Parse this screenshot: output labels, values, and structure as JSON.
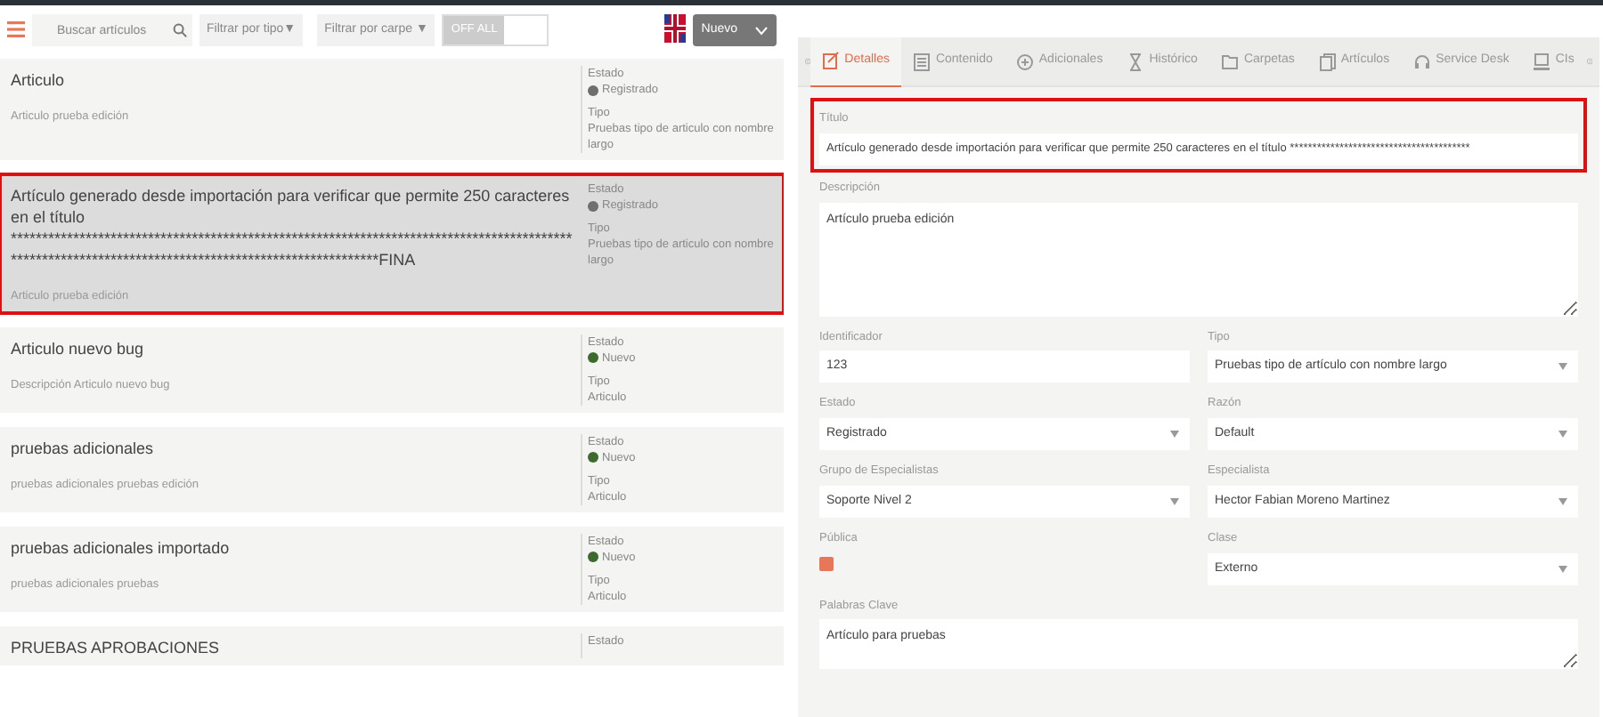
{
  "toolbar": {
    "search": {
      "placeholder": "Buscar artículos"
    },
    "filters": [
      {
        "label": "Filtrar por tipo▼"
      },
      {
        "label": "Filtrar por carpe ▼"
      }
    ],
    "toggle": {
      "label": "OFF ALL",
      "on": false
    },
    "new_button": {
      "label": "Nuevo"
    }
  },
  "articles": [
    {
      "title": "Articulo",
      "description": "Articulo prueba edición",
      "estado_label": "Estado",
      "status": "Registrado",
      "color": "#6f6f6f",
      "tipo_label": "Tipo",
      "tipo": "Pruebas tipo de articulo con nombre largo",
      "selected": false,
      "highlighted": false
    },
    {
      "title": "Artículo generado desde importación para verificar que permite 250 caracteres en el título *****************************************************************************************************************************************************FINA",
      "description": "Articulo prueba edición",
      "estado_label": "Estado",
      "status": "Registrado",
      "color": "#6f6f6f",
      "tipo_label": "Tipo",
      "tipo": "Pruebas tipo de articulo con nombre largo",
      "selected": true,
      "highlighted": true
    },
    {
      "title": "Articulo nuevo bug",
      "description": "Descripción Articulo nuevo bug",
      "estado_label": "Estado",
      "status": "Nuevo",
      "color": "#3d6b2f",
      "tipo_label": "Tipo",
      "tipo": "Articulo",
      "selected": false,
      "highlighted": false
    },
    {
      "title": "pruebas adicionales",
      "description": "pruebas adicionales pruebas edición",
      "estado_label": "Estado",
      "status": "Nuevo",
      "color": "#3d6b2f",
      "tipo_label": "Tipo",
      "tipo": "Articulo",
      "selected": false,
      "highlighted": false
    },
    {
      "title": "pruebas adicionales importado",
      "description": "pruebas adicionales pruebas",
      "estado_label": "Estado",
      "status": "Nuevo",
      "color": "#3d6b2f",
      "tipo_label": "Tipo",
      "tipo": "Articulo",
      "selected": false,
      "highlighted": false
    },
    {
      "title": "PRUEBAS APROBACIONES",
      "estado_label": "Estado",
      "selected": false,
      "highlighted": false
    }
  ],
  "tabs": [
    {
      "label": "Detalles",
      "selected": true
    },
    {
      "label": "Contenido",
      "selected": false
    },
    {
      "label": "Adicionales",
      "selected": false
    },
    {
      "label": "Histórico",
      "selected": false
    },
    {
      "label": "Carpetas",
      "selected": false
    },
    {
      "label": "Artículos",
      "selected": false
    },
    {
      "label": "Service Desk",
      "selected": false
    },
    {
      "label": "CIs",
      "selected": false
    }
  ],
  "form": {
    "title_field": {
      "label": "Título",
      "value": "Artículo generado desde importación para verificar que permite 250 caracteres en el título ****************************************",
      "highlighted": true
    },
    "fields": [
      {
        "kind": "textarea",
        "label": "Descripción",
        "value": "Artículo prueba edición"
      },
      {
        "kind": "text",
        "label": "Identificador",
        "value": "123"
      },
      {
        "kind": "select",
        "label": "Tipo",
        "value": "Pruebas tipo de artículo con nombre largo"
      },
      {
        "kind": "select",
        "label": "Estado",
        "value": "Registrado"
      },
      {
        "kind": "select",
        "label": "Razón",
        "value": "Default"
      },
      {
        "kind": "select",
        "label": "Grupo de Especialistas",
        "value": "Soporte Nivel 2"
      },
      {
        "kind": "select",
        "label": "Especialista",
        "value": "Hector Fabian Moreno Martinez"
      },
      {
        "kind": "checkbox",
        "label": "Pública",
        "checked": true
      },
      {
        "kind": "select",
        "label": "Clase",
        "value": "Externo"
      },
      {
        "kind": "textarea",
        "label": "Palabras Clave",
        "value": "Artículo para pruebas"
      }
    ]
  }
}
